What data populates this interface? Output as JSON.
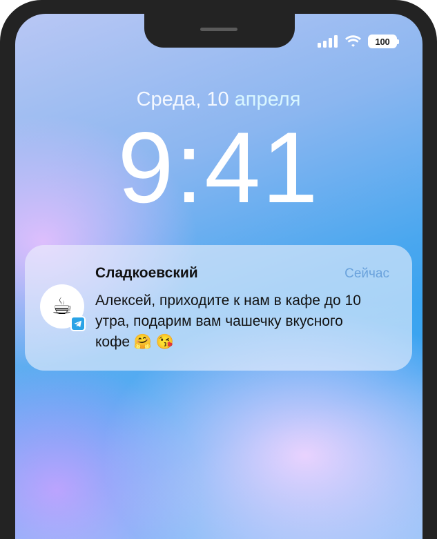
{
  "status_bar": {
    "battery_level": "100",
    "icons": [
      "cellular-signal-icon",
      "wifi-icon",
      "battery-icon"
    ]
  },
  "lock_screen": {
    "date_weekday": "Среда,",
    "date_day": "10",
    "date_month": "апреля",
    "time": "9:41"
  },
  "notification": {
    "app_icon": "coffee-cup-icon",
    "badge_icon": "telegram-icon",
    "sender": "Сладкоевский",
    "timestamp": "Сейчас",
    "message": "Алексей, приходите к нам в кафе до 10 утра, подарим вам чашечку вкусного кофе 🤗 😘"
  },
  "colors": {
    "time_text": "#ffffff",
    "date_accent": "#d8f6ff",
    "timestamp_text": "#6aa2dc",
    "telegram_badge": "#2aa3e6"
  }
}
